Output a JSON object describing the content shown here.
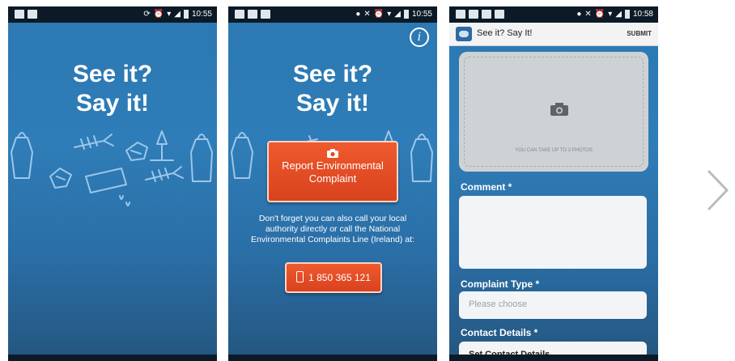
{
  "screens": [
    {
      "status": {
        "time": "10:55"
      },
      "headline": {
        "line1": "See it?",
        "line2": "Say it!"
      }
    },
    {
      "status": {
        "time": "10:55"
      },
      "headline": {
        "line1": "See it?",
        "line2": "Say it!"
      },
      "report_button": "Report Environmental Complaint",
      "info_text": "Don't forget you can also call your local authority directly or call the National Environmental Complaints Line (Ireland) at:",
      "phone_button": "1 850 365 121"
    },
    {
      "status": {
        "time": "10:58"
      },
      "app_title": "See it? Say It!",
      "submit_label": "SUBMIT",
      "photo_note": "YOU CAN TAKE UP TO 3 PHOTOS",
      "comment_label": "Comment *",
      "complaint_type_label": "Complaint Type *",
      "complaint_type_placeholder": "Please choose",
      "contact_label": "Contact Details *",
      "contact_button": "Set Contact Details"
    }
  ],
  "colors": {
    "background_blue": "#2f7db8",
    "button_orange": "#e04b24",
    "doodle_stroke": "#9cc6ea"
  },
  "icons": [
    "camera-icon",
    "info-icon",
    "phone-icon",
    "chevron-right-icon"
  ]
}
